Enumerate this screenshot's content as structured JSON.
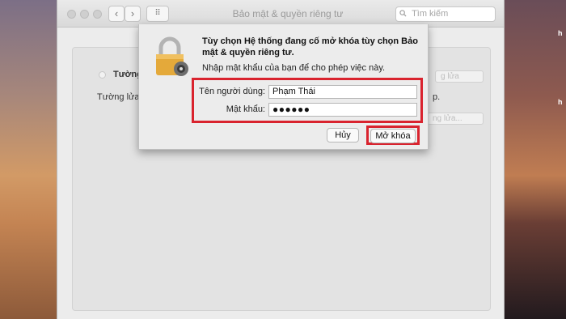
{
  "window": {
    "title": "Bảo mật & quyền riêng tư",
    "search_placeholder": "Tìm kiếm",
    "back_glyph": "‹",
    "forward_glyph": "›",
    "grid_glyph": "⠿",
    "search_icon": "search-icon"
  },
  "background": {
    "firewall_label": "Tường",
    "firewall_desc": "Tường lửa c",
    "button_1": "g lửa",
    "button_2": "ng lửa...",
    "period_text": "p."
  },
  "desktop": {
    "labels": [
      "h",
      "h"
    ]
  },
  "dialog": {
    "title": "Tùy chọn Hệ thống đang cố mở khóa tùy chọn Bảo mật & quyền riêng tư.",
    "subtitle": "Nhập mật khẩu của bạn để cho phép việc này.",
    "username_label": "Tên người dùng:",
    "username_value": "Phạm Thái",
    "password_label": "Mật khẩu:",
    "password_value": "●●●●●●",
    "cancel_label": "Hủy",
    "unlock_label": "Mở khóa"
  },
  "colors": {
    "highlight": "#d9232e"
  }
}
